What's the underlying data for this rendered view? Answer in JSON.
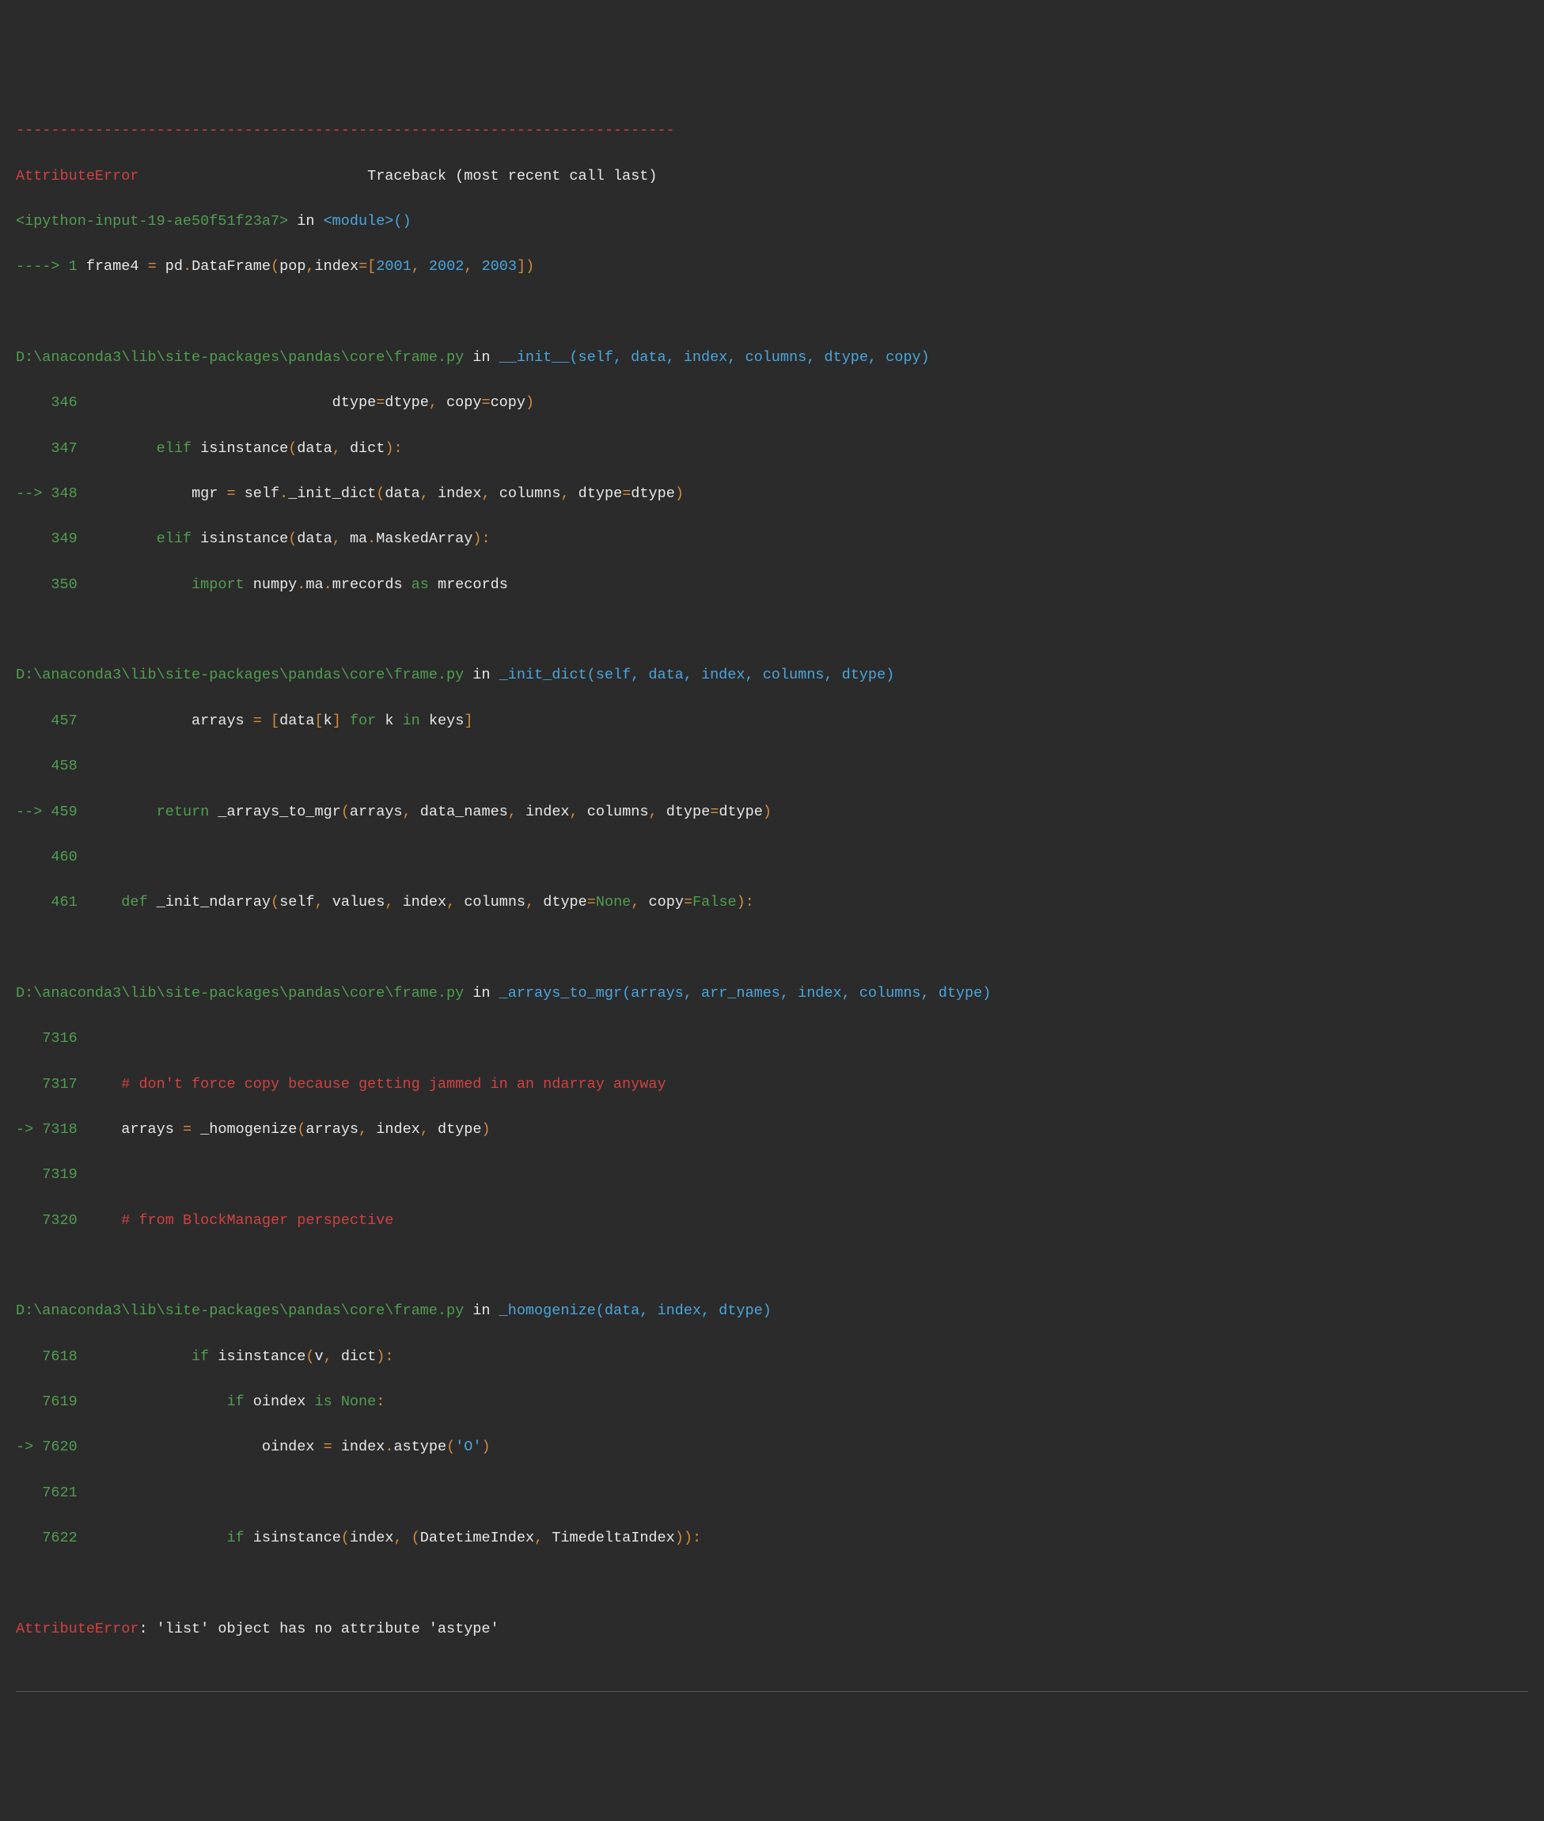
{
  "separator": "---------------------------------------------------------------------------",
  "header": {
    "error_name": "AttributeError",
    "spacer": "                          ",
    "traceback_label": "Traceback (most recent call last)"
  },
  "top_frame": {
    "file": "<ipython-input-19-ae50f51f23a7>",
    "in": " in ",
    "func": "<module>",
    "parens": "()",
    "arrow": "----> ",
    "lineno": "1",
    "sp": " ",
    "code_a": "frame4 ",
    "eq": "=",
    "code_b": " pd",
    "dot1": ".",
    "code_c": "DataFrame",
    "paren_o": "(",
    "arg1": "pop",
    "comma1": ",",
    "arg2": "index",
    "eq2": "=[",
    "n1": "2001",
    "c2": ", ",
    "n2": "2002",
    "c3": ", ",
    "n3": "2003",
    "close": "])"
  },
  "frame1": {
    "path": "D:\\anaconda3\\lib\\site-packages\\pandas\\core\\frame.py",
    "in": " in ",
    "func": "__init__",
    "sig": "(self, data, index, columns, dtype, copy)",
    "l346_no": "    346",
    "l346_sp": "                             ",
    "l346_a": "dtype",
    "l346_eq": "=",
    "l346_b": "dtype",
    "l346_c": ", ",
    "l346_d": "copy",
    "l346_eq2": "=",
    "l346_e": "copy",
    "l346_close": ")",
    "l347_no": "    347",
    "l347_sp": "         ",
    "l347_kw": "elif",
    "l347_a": " isinstance",
    "l347_po": "(",
    "l347_b": "data",
    "l347_c": ", ",
    "l347_d": "dict",
    "l347_close": "):",
    "l348_arrow": "--> ",
    "l348_no": "348",
    "l348_sp": "             ",
    "l348_a": "mgr ",
    "l348_eq": "=",
    "l348_b": " self",
    "l348_dot": ".",
    "l348_c": "_init_dict",
    "l348_po": "(",
    "l348_d": "data",
    "l348_e": ", ",
    "l348_f": "index",
    "l348_g": ", ",
    "l348_h": "columns",
    "l348_i": ", ",
    "l348_j": "dtype",
    "l348_eq2": "=",
    "l348_k": "dtype",
    "l348_close": ")",
    "l349_no": "    349",
    "l349_sp": "         ",
    "l349_kw": "elif",
    "l349_a": " isinstance",
    "l349_po": "(",
    "l349_b": "data",
    "l349_c": ", ",
    "l349_d": "ma",
    "l349_dot": ".",
    "l349_e": "MaskedArray",
    "l349_close": "):",
    "l350_no": "    350",
    "l350_sp": "             ",
    "l350_kw": "import",
    "l350_a": " numpy",
    "l350_dot": ".",
    "l350_b": "ma",
    "l350_dot2": ".",
    "l350_c": "mrecords ",
    "l350_as": "as",
    "l350_d": " mrecords"
  },
  "frame2": {
    "path": "D:\\anaconda3\\lib\\site-packages\\pandas\\core\\frame.py",
    "in": " in ",
    "func": "_init_dict",
    "sig": "(self, data, index, columns, dtype)",
    "l457_no": "    457",
    "l457_sp": "             ",
    "l457_a": "arrays ",
    "l457_eq": "=",
    "l457_b": " ",
    "l457_br": "[",
    "l457_c": "data",
    "l457_br2": "[",
    "l457_d": "k",
    "l457_br3": "]",
    "l457_sp2": " ",
    "l457_for": "for",
    "l457_e": " k ",
    "l457_in": "in",
    "l457_f": " keys",
    "l457_close": "]",
    "l458_no": "    458",
    "l459_arrow": "--> ",
    "l459_no": "459",
    "l459_sp": "         ",
    "l459_ret": "return",
    "l459_a": " _arrays_to_mgr",
    "l459_po": "(",
    "l459_b": "arrays",
    "l459_c": ", ",
    "l459_d": "data_names",
    "l459_e": ", ",
    "l459_f": "index",
    "l459_g": ", ",
    "l459_h": "columns",
    "l459_i": ", ",
    "l459_j": "dtype",
    "l459_eq": "=",
    "l459_k": "dtype",
    "l459_close": ")",
    "l460_no": "    460",
    "l461_no": "    461",
    "l461_sp": "     ",
    "l461_def": "def",
    "l461_a": " _init_ndarray",
    "l461_po": "(",
    "l461_b": "self",
    "l461_c": ", ",
    "l461_d": "values",
    "l461_e": ", ",
    "l461_f": "index",
    "l461_g": ", ",
    "l461_h": "columns",
    "l461_i": ", ",
    "l461_j": "dtype",
    "l461_eq": "=",
    "l461_none": "None",
    "l461_k": ", ",
    "l461_l": "copy",
    "l461_eq2": "=",
    "l461_false": "False",
    "l461_close": "):"
  },
  "frame3": {
    "path": "D:\\anaconda3\\lib\\site-packages\\pandas\\core\\frame.py",
    "in": " in ",
    "func": "_arrays_to_mgr",
    "sig": "(arrays, arr_names, index, columns, dtype)",
    "l7316_no": "   7316",
    "l7317_no": "   7317",
    "l7317_sp": "     ",
    "l7317_cmt": "# don't force copy because getting jammed in an ndarray anyway",
    "l7318_arrow": "-> ",
    "l7318_no": "7318",
    "l7318_sp": "     ",
    "l7318_a": "arrays ",
    "l7318_eq": "=",
    "l7318_b": " _homogenize",
    "l7318_po": "(",
    "l7318_c": "arrays",
    "l7318_d": ", ",
    "l7318_e": "index",
    "l7318_f": ", ",
    "l7318_g": "dtype",
    "l7318_close": ")",
    "l7319_no": "   7319",
    "l7320_no": "   7320",
    "l7320_sp": "     ",
    "l7320_cmt": "# from BlockManager perspective"
  },
  "frame4": {
    "path": "D:\\anaconda3\\lib\\site-packages\\pandas\\core\\frame.py",
    "in": " in ",
    "func": "_homogenize",
    "sig": "(data, index, dtype)",
    "l7618_no": "   7618",
    "l7618_sp": "             ",
    "l7618_if": "if",
    "l7618_a": " isinstance",
    "l7618_po": "(",
    "l7618_b": "v",
    "l7618_c": ", ",
    "l7618_d": "dict",
    "l7618_close": "):",
    "l7619_no": "   7619",
    "l7619_sp": "                 ",
    "l7619_if": "if",
    "l7619_a": " oindex ",
    "l7619_is": "is",
    "l7619_sp2": " ",
    "l7619_none": "None",
    "l7619_close": ":",
    "l7620_arrow": "-> ",
    "l7620_no": "7620",
    "l7620_sp": "                     ",
    "l7620_a": "oindex ",
    "l7620_eq": "=",
    "l7620_b": " index",
    "l7620_dot": ".",
    "l7620_c": "astype",
    "l7620_po": "(",
    "l7620_str": "'O'",
    "l7620_close": ")",
    "l7621_no": "   7621",
    "l7622_no": "   7622",
    "l7622_sp": "                 ",
    "l7622_if": "if",
    "l7622_a": " isinstance",
    "l7622_po": "(",
    "l7622_b": "index",
    "l7622_c": ", ",
    "l7622_po2": "(",
    "l7622_d": "DatetimeIndex",
    "l7622_e": ", ",
    "l7622_f": "TimedeltaIndex",
    "l7622_close": ")):"
  },
  "final": {
    "err": "AttributeError",
    "msg": ": 'list' object has no attribute 'astype'"
  }
}
